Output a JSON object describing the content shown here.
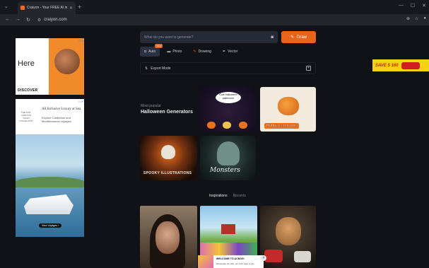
{
  "browser": {
    "tab_title": "Craiyon - Your FREE AI image g...",
    "tab_close": "✕",
    "new_tab": "+",
    "address": "craiyon.com"
  },
  "ads": {
    "left_top": {
      "headline": "Here",
      "brand": "DISCOVER"
    },
    "left_bottom": {
      "headline": "All Inclusive Luxury at Sea",
      "subtitle": "Explore Caribbean and Mediterranean voyages",
      "brand": "THE RITZ-CARLTON YACHT COLLECTION",
      "cta": "View Voyages  ›"
    },
    "right": {
      "save_text": "SAVE $ 160"
    },
    "promo": {
      "title": "WELCOME TO ACNOS!",
      "subtitle": "Reconsider the 10th, you won't have to pay"
    }
  },
  "generator": {
    "placeholder": "What do you want to generate?",
    "draw_label": "Draw",
    "modes": [
      {
        "label": "Auto",
        "badge": "NEW"
      },
      {
        "label": "Photo"
      },
      {
        "label": "Drawing"
      },
      {
        "label": "Vector"
      }
    ],
    "export_label": "Export Mode"
  },
  "popular": {
    "small": "Most popular",
    "title": "Halloween Generators",
    "cards": [
      {
        "label": "Cute Halloween watercolor"
      },
      {
        "label": "Halloween Icons"
      },
      {
        "label": "SPOOKY ILLUSTRATIONS"
      },
      {
        "label": "Monsters"
      }
    ]
  },
  "inspirations": {
    "tab_on": "Inspirations",
    "tab_off": "Recents"
  },
  "colors": {
    "accent": "#e8641b",
    "bg": "#101217"
  }
}
